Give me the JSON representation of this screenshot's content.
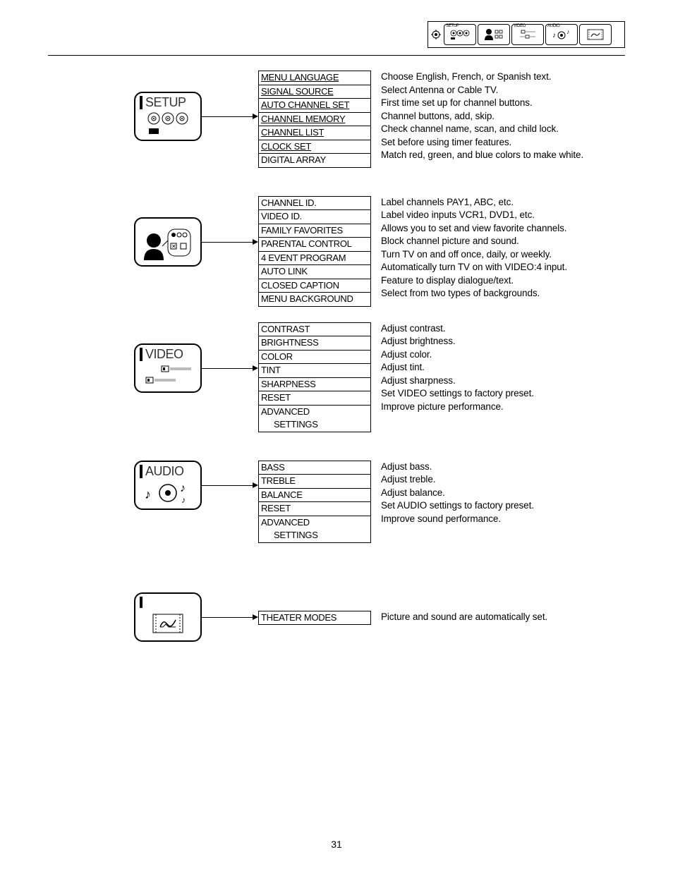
{
  "header": {
    "tabs": [
      "SETUP",
      "",
      "VIDEO",
      "AUDIO",
      ""
    ]
  },
  "sections": [
    {
      "title": "SETUP",
      "items": [
        {
          "label": "MENU LANGUAGE",
          "underline": true,
          "desc": "Choose English, French, or Spanish text."
        },
        {
          "label": "SIGNAL SOURCE",
          "underline": true,
          "desc": "Select Antenna or Cable TV."
        },
        {
          "label": "AUTO CHANNEL SET",
          "underline": true,
          "desc": "First time set up for channel buttons."
        },
        {
          "label": "CHANNEL MEMORY",
          "underline": true,
          "desc": "Channel buttons, add, skip."
        },
        {
          "label": "CHANNEL LIST",
          "underline": true,
          "desc": "Check channel name, scan, and child lock."
        },
        {
          "label": "CLOCK SET",
          "underline": true,
          "desc": "Set before using timer features."
        },
        {
          "label": "DIGITAL ARRAY",
          "underline": false,
          "desc": "Match red, green, and blue colors to make white."
        }
      ]
    },
    {
      "title": "",
      "items": [
        {
          "label": "CHANNEL ID.",
          "desc": "Label channels PAY1, ABC, etc."
        },
        {
          "label": "VIDEO ID.",
          "desc": "Label video inputs VCR1, DVD1, etc."
        },
        {
          "label": "FAMILY FAVORITES",
          "desc": "Allows you to set and view favorite channels."
        },
        {
          "label": "PARENTAL CONTROL",
          "desc": "Block channel picture and sound."
        },
        {
          "label": "4 EVENT PROGRAM",
          "desc": "Turn TV on and off once, daily, or weekly."
        },
        {
          "label": "AUTO LINK",
          "desc": "Automatically turn TV on with VIDEO:4 input."
        },
        {
          "label": "CLOSED CAPTION",
          "desc": "Feature to display dialogue/text."
        },
        {
          "label": "MENU BACKGROUND",
          "desc": "Select from two types of backgrounds."
        }
      ]
    },
    {
      "title": "VIDEO",
      "items": [
        {
          "label": "CONTRAST",
          "desc": "Adjust contrast."
        },
        {
          "label": "BRIGHTNESS",
          "desc": "Adjust brightness."
        },
        {
          "label": "COLOR",
          "desc": "Adjust color."
        },
        {
          "label": "TINT",
          "desc": "Adjust tint."
        },
        {
          "label": "SHARPNESS",
          "desc": "Adjust sharpness."
        },
        {
          "label": "RESET",
          "desc": "Set VIDEO settings to factory preset."
        },
        {
          "label": "ADVANCED",
          "sub": "SETTINGS",
          "desc": "Improve picture performance."
        }
      ]
    },
    {
      "title": "AUDIO",
      "items": [
        {
          "label": "BASS",
          "desc": "Adjust bass."
        },
        {
          "label": "TREBLE",
          "desc": "Adjust treble."
        },
        {
          "label": "BALANCE",
          "desc": "Adjust balance."
        },
        {
          "label": "RESET",
          "desc": "Set AUDIO settings to factory preset."
        },
        {
          "label": "ADVANCED",
          "sub": "SETTINGS",
          "desc": "Improve sound performance."
        }
      ]
    },
    {
      "title": "",
      "items": [
        {
          "label": "THEATER MODES",
          "desc": "Picture and sound are automatically set."
        }
      ]
    }
  ],
  "page_number": "31"
}
